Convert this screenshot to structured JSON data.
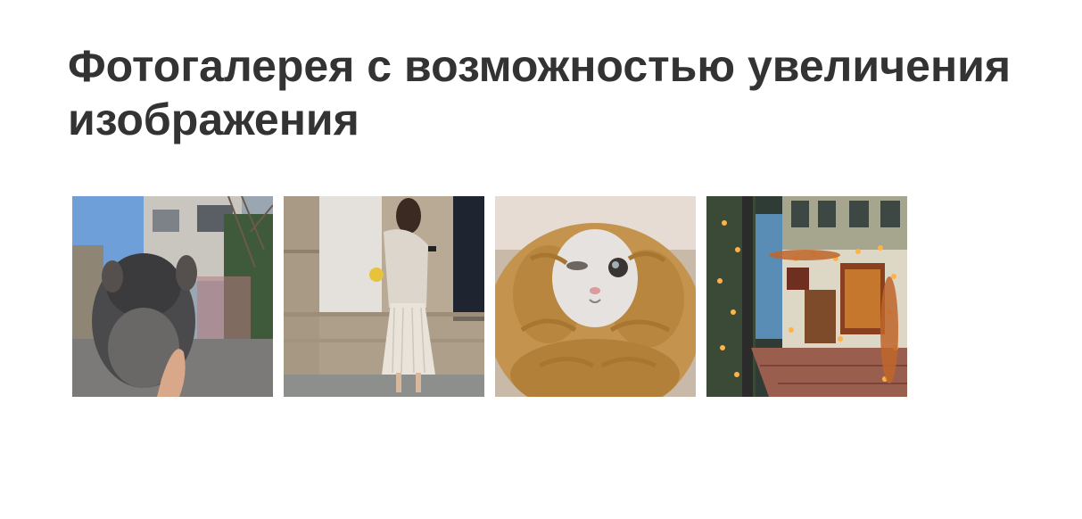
{
  "page": {
    "title": "Фотогалерея с возможностью увеличения изображения"
  },
  "gallery": {
    "items": [
      {
        "name": "chinchilla-photo",
        "subject": "chinchilla held in hand outdoors"
      },
      {
        "name": "woman-photo",
        "subject": "woman in pleated skirt looking at phone by stone wall"
      },
      {
        "name": "cat-photo",
        "subject": "cat wrapped in knitted mustard blanket"
      },
      {
        "name": "street-photo",
        "subject": "festive storefront with lights on brick street"
      }
    ]
  },
  "colors": {
    "title": "#333333",
    "background": "#ffffff"
  }
}
